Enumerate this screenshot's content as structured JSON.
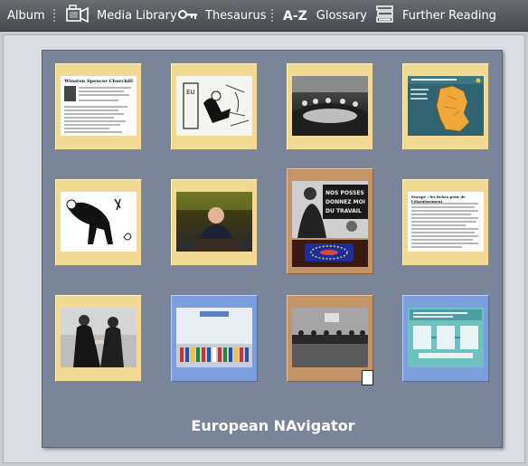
{
  "toolbar": {
    "album": "Album",
    "media_library": "Media Library",
    "thesaurus": "Thesaurus",
    "glossary_icon": "A-Z",
    "glossary": "Glossary",
    "further_reading": "Further Reading"
  },
  "panel": {
    "brand": "European NAvigator"
  },
  "tiles": [
    {
      "kind": "document",
      "frame": "yellow",
      "title": "Winston Spencer Churchill"
    },
    {
      "kind": "cartoon",
      "frame": "yellow",
      "sign": "EU"
    },
    {
      "kind": "photo-meeting",
      "frame": "yellow"
    },
    {
      "kind": "map",
      "frame": "yellow"
    },
    {
      "kind": "cartoon-figure",
      "frame": "yellow"
    },
    {
      "kind": "photo-speaker",
      "frame": "yellow"
    },
    {
      "kind": "photo-protest",
      "frame": "brown",
      "banner": "NOS POSSES DONNEZ MOI DU TRAVAIL"
    },
    {
      "kind": "document",
      "frame": "yellow",
      "title": "Europe : les fiches pour de l'élargissement"
    },
    {
      "kind": "photo-handshake",
      "frame": "yellow"
    },
    {
      "kind": "photo-flags",
      "frame": "blue"
    },
    {
      "kind": "photo-conference",
      "frame": "brown"
    },
    {
      "kind": "diagram",
      "frame": "blue"
    }
  ],
  "colors": {
    "toolbar": "#55585d",
    "panel": "#7b8599",
    "tile_yellow": "#f2da92",
    "tile_blue": "#7c9fdd",
    "tile_brown": "#c49366"
  }
}
